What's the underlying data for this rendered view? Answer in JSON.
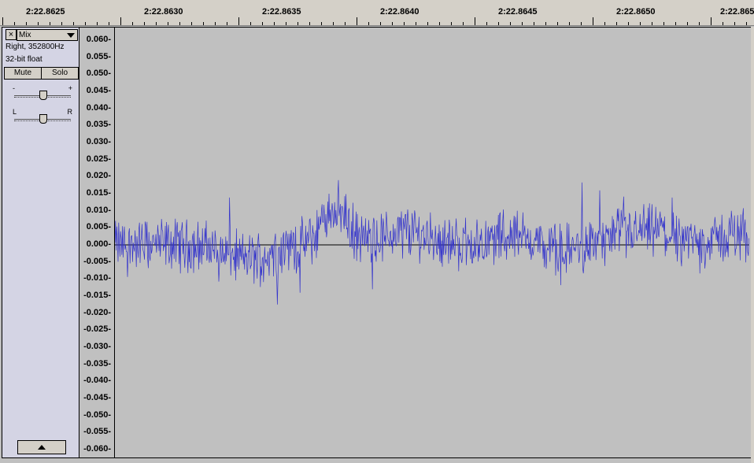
{
  "ruler": {
    "labels": [
      "2:22.8625",
      "2:22.8630",
      "2:22.8635",
      "2:22.8640",
      "2:22.8645",
      "2:22.8650",
      "2:22.865"
    ]
  },
  "track": {
    "close_label": "×",
    "name": "Mix",
    "channel_info": "Right, 352800Hz",
    "format": "32-bit float",
    "mute_label": "Mute",
    "solo_label": "Solo",
    "gain_minus": "-",
    "gain_plus": "+",
    "pan_left": "L",
    "pan_right": "R"
  },
  "y_axis": {
    "labels": [
      "0.060-",
      "0.055-",
      "0.050-",
      "0.045-",
      "0.040-",
      "0.035-",
      "0.030-",
      "0.025-",
      "0.020-",
      "0.015-",
      "0.010-",
      "0.005-",
      "0.000-",
      "-0.005-",
      "-0.010-",
      "-0.015-",
      "-0.020-",
      "-0.025-",
      "-0.030-",
      "-0.035-",
      "-0.040-",
      "-0.045-",
      "-0.050-",
      "-0.055-",
      "-0.060-"
    ]
  },
  "colors": {
    "waveform": "#3333cc",
    "background": "#c0c0c0",
    "track_panel": "#d4d4e4"
  },
  "chart_data": {
    "type": "line",
    "ylim": [
      -0.06,
      0.06
    ],
    "x_range": [
      "2:22.8623",
      "2:22.8650"
    ]
  }
}
